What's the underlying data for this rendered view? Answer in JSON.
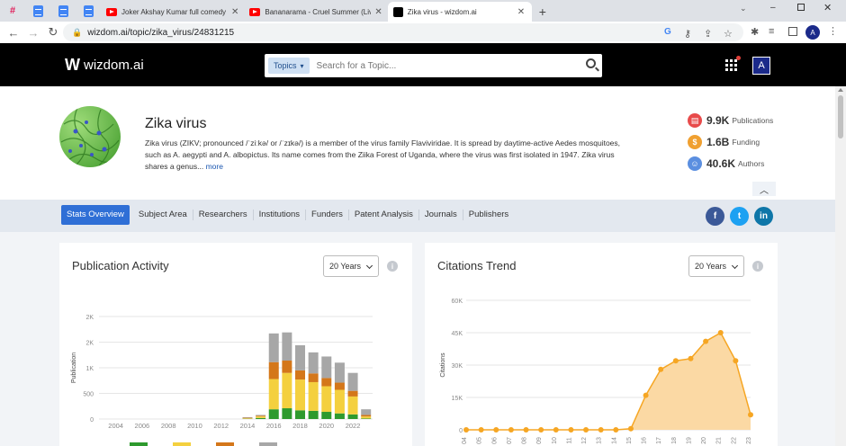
{
  "browser": {
    "tabs": [
      {
        "title": "Joker Akshay Kumar full comedy",
        "icon": "youtube-icon"
      },
      {
        "title": "Bananarama - Cruel Summer (Liv",
        "icon": "youtube-icon"
      },
      {
        "title": "Zika virus - wizdom.ai",
        "icon": "wizdom-icon",
        "active": true
      }
    ],
    "url": "wizdom.ai/topic/zika_virus/24831215",
    "profile_initial": "A"
  },
  "site": {
    "logo_text": "wizdom.ai",
    "search_category": "Topics",
    "search_placeholder": "Search for a Topic...",
    "user_initial": "A"
  },
  "topic": {
    "title": "Zika virus",
    "description": "Zika virus (ZIKV; pronounced /ˈziːkə/ or /ˈzɪkə/) is a member of the virus family Flaviviridae. It is spread by daytime-active Aedes mosquitoes, such as A. aegypti and A. albopictus. Its name comes from the Ziika Forest of Uganda, where the virus was first isolated in 1947. Zika virus shares a genus...",
    "more_label": "more",
    "stats": [
      {
        "value": "9.9K",
        "label": "Publications",
        "color": "#e84b4b"
      },
      {
        "value": "1.6B",
        "label": "Funding",
        "color": "#f0a030"
      },
      {
        "value": "40.6K",
        "label": "Authors",
        "color": "#5b8fe0"
      }
    ]
  },
  "subnav": {
    "items": [
      "Stats Overview",
      "Subject Area",
      "Researchers",
      "Institutions",
      "Funders",
      "Patent Analysis",
      "Journals",
      "Publishers"
    ],
    "active_index": 0,
    "social": [
      {
        "name": "facebook",
        "glyph": "f",
        "color": "#3b5998"
      },
      {
        "name": "twitter",
        "glyph": "t",
        "color": "#1da1f2"
      },
      {
        "name": "linkedin",
        "glyph": "in",
        "color": "#0e76a8"
      }
    ]
  },
  "cards": {
    "publication": {
      "title": "Publication Activity",
      "select": "20 Years"
    },
    "citations": {
      "title": "Citations Trend",
      "select": "20 Years"
    }
  },
  "chart_data": [
    {
      "type": "bar",
      "stacked": true,
      "ylabel": "Publication",
      "y_ticks": [
        "0",
        "500",
        "1K",
        "2K",
        "2K"
      ],
      "ylim": [
        0,
        2000
      ],
      "x_ticks": [
        "2004",
        "2006",
        "2008",
        "2010",
        "2012",
        "2014",
        "2016",
        "2018",
        "2020",
        "2022"
      ],
      "categories": [
        "2014",
        "2015",
        "2016",
        "2017",
        "2018",
        "2019",
        "2020",
        "2021",
        "2022",
        "2023"
      ],
      "series": [
        {
          "values": [
            5,
            20,
            190,
            210,
            170,
            160,
            140,
            110,
            90,
            10
          ],
          "color": "#2e9a2e"
        },
        {
          "values": [
            10,
            30,
            590,
            690,
            600,
            560,
            500,
            460,
            350,
            40
          ],
          "color": "#f4d03f"
        },
        {
          "values": [
            10,
            15,
            330,
            240,
            180,
            170,
            160,
            140,
            110,
            30
          ],
          "color": "#d4771a"
        },
        {
          "values": [
            10,
            15,
            560,
            550,
            490,
            410,
            420,
            390,
            350,
            110
          ],
          "color": "#a7a7a7"
        }
      ],
      "grid": true
    },
    {
      "type": "area",
      "ylabel": "Citations",
      "y_ticks": [
        "0",
        "15K",
        "30K",
        "45K",
        "60K"
      ],
      "ylim": [
        0,
        60000
      ],
      "x_ticks": [
        "04",
        "05",
        "06",
        "07",
        "08",
        "09",
        "10",
        "11",
        "12",
        "13",
        "14",
        "15",
        "16",
        "17",
        "18",
        "19",
        "20",
        "21",
        "22",
        "23"
      ],
      "values": [
        0,
        0,
        0,
        0,
        0,
        0,
        0,
        0,
        0,
        0,
        0,
        500,
        16000,
        28000,
        32000,
        33000,
        41000,
        45000,
        32000,
        7000
      ],
      "color": "#f6a623",
      "grid": true
    }
  ]
}
